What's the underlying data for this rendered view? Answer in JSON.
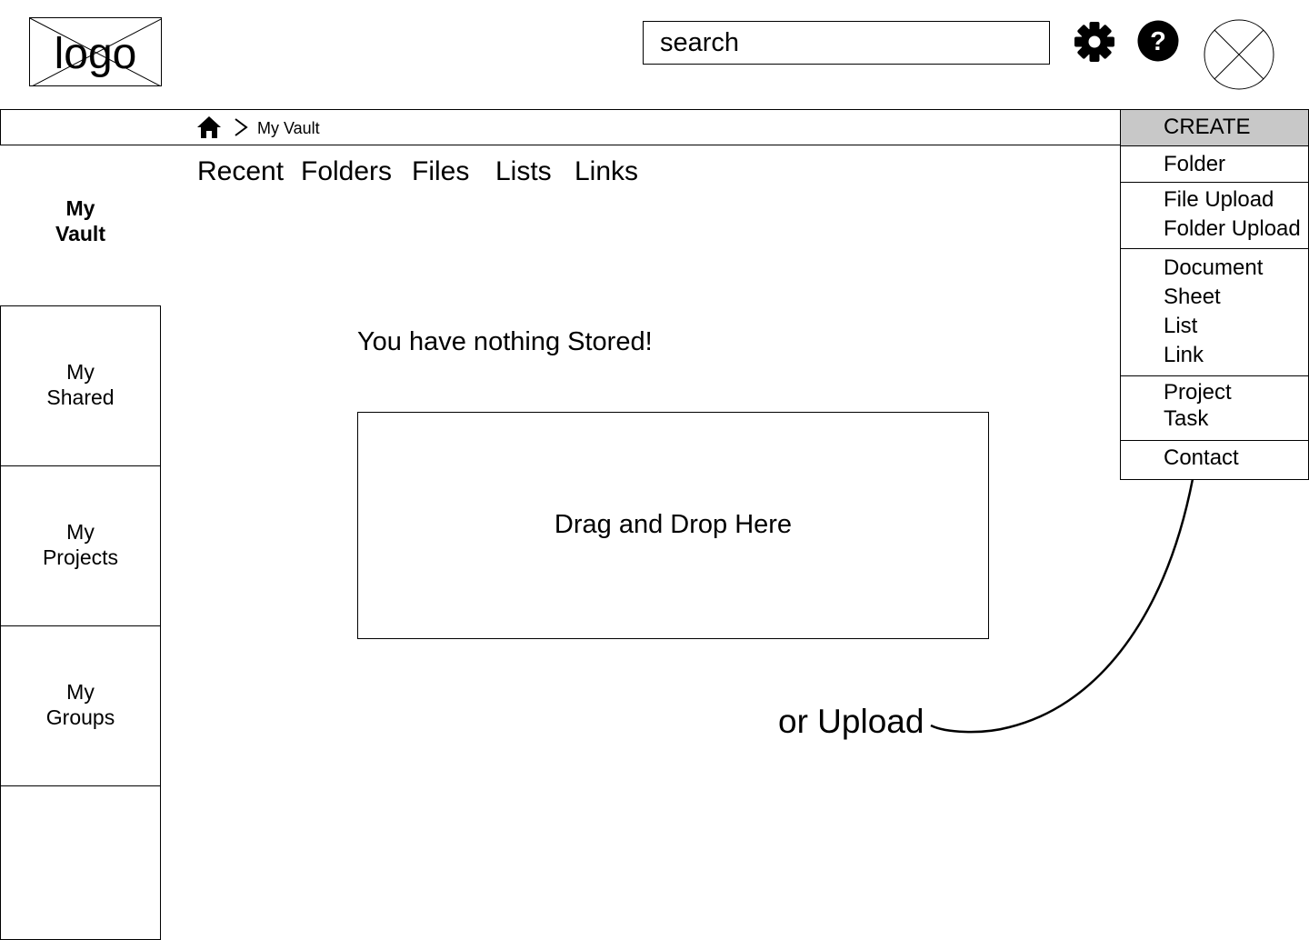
{
  "header": {
    "logo_text": "logo",
    "search_placeholder": "search",
    "settings_icon": "gear-icon",
    "help_icon": "help-icon",
    "avatar_icon": "avatar-placeholder"
  },
  "breadcrumb": {
    "home_icon": "home-icon",
    "separator_icon": "chevron-right-icon",
    "current": "My Vault"
  },
  "sidebar": {
    "items": [
      {
        "label": "My\nVault",
        "active": true
      },
      {
        "label": "My\nShared"
      },
      {
        "label": "My\nProjects"
      },
      {
        "label": "My\nGroups"
      }
    ]
  },
  "tabs": [
    {
      "label": "Recent"
    },
    {
      "label": "Folders"
    },
    {
      "label": "Files"
    },
    {
      "label": "Lists"
    },
    {
      "label": "Links"
    }
  ],
  "main": {
    "empty_message": "You have nothing Stored!",
    "dropzone_label": "Drag and Drop Here",
    "upload_hint": "or Upload"
  },
  "create_menu": {
    "header": "CREATE",
    "sections": [
      [
        "Folder"
      ],
      [
        "File Upload",
        "Folder Upload"
      ],
      [
        "Document",
        "Sheet",
        "List",
        "Link"
      ],
      [
        "Project",
        "Task"
      ],
      [
        "Contact"
      ]
    ]
  },
  "colors": {
    "menu_header_bg": "#c8c8c8",
    "line": "#000000",
    "background": "#ffffff"
  }
}
